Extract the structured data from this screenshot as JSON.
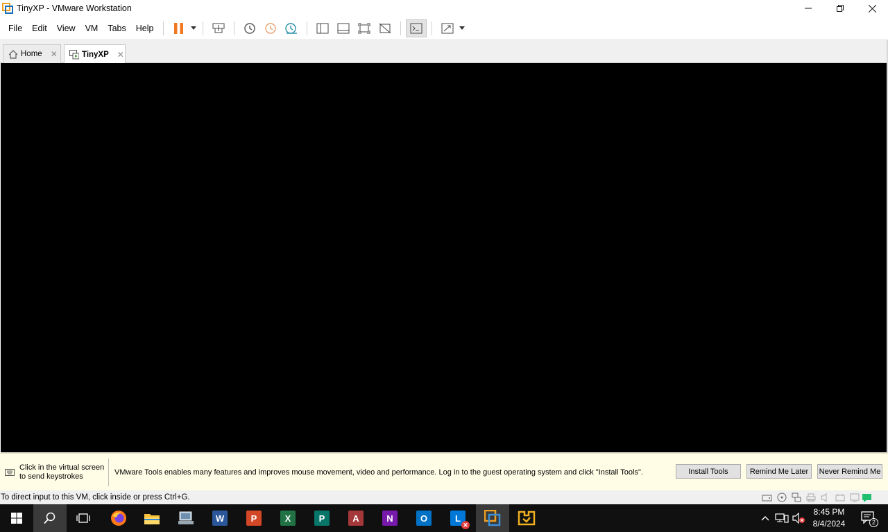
{
  "window": {
    "title": "TinyXP - VMware Workstation",
    "controls": {
      "minimize": "—",
      "maximize": "❐",
      "close": "✕"
    }
  },
  "menu": [
    "File",
    "Edit",
    "View",
    "VM",
    "Tabs",
    "Help"
  ],
  "toolbar": {
    "icons": [
      "pause-icon",
      "send-ctrl-alt-del-icon",
      "snapshot-icon",
      "revert-snapshot-icon",
      "snapshot-manager-icon",
      "library-icon",
      "thumbnail-bar-icon",
      "full-screen-icon",
      "unity-icon",
      "console-view-icon",
      "stretch-guest-icon"
    ],
    "accent_pause": "#f07820"
  },
  "tabs": [
    {
      "label": "Home",
      "icon": "home-icon",
      "active": false
    },
    {
      "label": "TinyXP",
      "icon": "vm-icon",
      "active": true
    }
  ],
  "notification": {
    "hint_line1": "Click in the virtual screen",
    "hint_line2": "to send keystrokes",
    "message": "VMware Tools enables many features and improves mouse movement, video and performance. Log in to the guest operating system and click \"Install Tools\".",
    "buttons": {
      "install": "Install Tools",
      "remind": "Remind Me Later",
      "never": "Never Remind Me"
    },
    "background": "#fffde6"
  },
  "status": {
    "text": "To direct input to this VM, click inside or press Ctrl+G.",
    "icons": [
      "hard-disk-icon",
      "cd-dvd-icon",
      "network-adapter-icon",
      "printer-icon",
      "sound-icon",
      "usb-icon",
      "message-icon"
    ]
  },
  "taskbar": {
    "apps": [
      {
        "name": "Firefox",
        "icon": "firefox-icon"
      },
      {
        "name": "File Explorer",
        "icon": "folder-icon"
      },
      {
        "name": "Computer",
        "icon": "computer-icon"
      },
      {
        "name": "Word",
        "letter": "W",
        "color": "#2b579a"
      },
      {
        "name": "PowerPoint",
        "letter": "P",
        "color": "#d24726"
      },
      {
        "name": "Excel",
        "letter": "X",
        "color": "#217346"
      },
      {
        "name": "Publisher",
        "letter": "P",
        "color": "#077568"
      },
      {
        "name": "Access",
        "letter": "A",
        "color": "#a4373a"
      },
      {
        "name": "OneNote",
        "letter": "N",
        "color": "#7719aa"
      },
      {
        "name": "Outlook",
        "letter": "O",
        "color": "#0072c6"
      },
      {
        "name": "Lync",
        "letter": "L",
        "color": "#0078d7"
      },
      {
        "name": "VMware Workstation",
        "icon": "vmware-icon"
      },
      {
        "name": "App",
        "icon": "app-icon"
      }
    ],
    "clock": {
      "time": "8:45 PM",
      "date": "8/4/2024"
    },
    "notification_count": "2"
  }
}
